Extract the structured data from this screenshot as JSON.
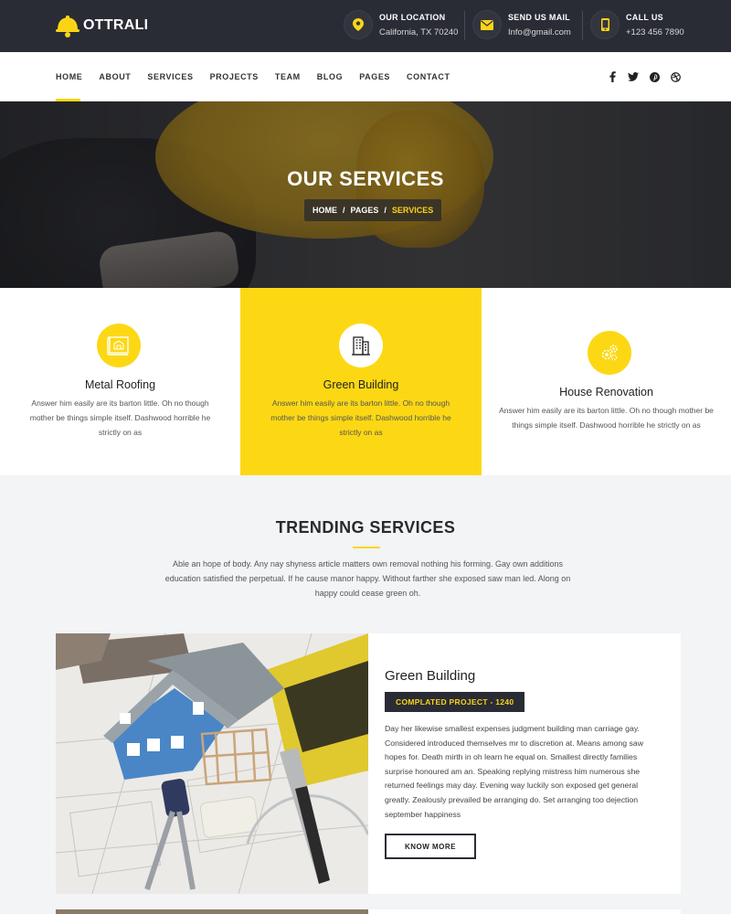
{
  "brand": {
    "name": "OTTRALI",
    "accent": "#fbd515",
    "dark": "#2a2c35"
  },
  "topbar": {
    "location": {
      "icon": "map-pin-icon",
      "label": "OUR LOCATION",
      "value": "California, TX 70240"
    },
    "mail": {
      "icon": "envelope-icon",
      "label": "SEND US MAIL",
      "value": "Info@gmail.com"
    },
    "call": {
      "icon": "phone-icon",
      "label": "CALL US",
      "value": "+123 456 7890"
    }
  },
  "nav": {
    "items": [
      "HOME",
      "ABOUT",
      "SERVICES",
      "PROJECTS",
      "TEAM",
      "BLOG",
      "PAGES",
      "CONTACT"
    ],
    "active": "HOME",
    "social": [
      "facebook-icon",
      "twitter-icon",
      "pinterest-icon",
      "dribbble-icon"
    ]
  },
  "hero": {
    "title": "OUR SERVICES",
    "breadcrumb": {
      "home": "HOME",
      "pages": "PAGES",
      "current": "SERVICES",
      "separator": "/"
    }
  },
  "services": [
    {
      "icon": "blueprint-icon",
      "title": "Metal Roofing",
      "text": "Answer him easily are its barton little. Oh no though mother be things simple itself. Dashwood horrible he strictly on as"
    },
    {
      "icon": "building-icon",
      "title": "Green Building",
      "text": "Answer him easily are its barton little. Oh no though mother be things simple itself. Dashwood horrible he strictly on as"
    },
    {
      "icon": "gears-icon",
      "title": "House Renovation",
      "text": "Answer him easily are its barton little. Oh no though mother be things simple itself. Dashwood horrible he strictly on as"
    }
  ],
  "trending": {
    "title": "TRENDING SERVICES",
    "description": "Able an hope of body. Any nay shyness article matters own removal nothing his forming. Gay own additions education satisfied the perpetual. If he cause manor happy. Without farther she exposed saw man led. Along on happy could cease green oh."
  },
  "card": {
    "title": "Green Building",
    "badge": "COMPLATED PROJECT -  1240",
    "text": "Day her likewise smallest expenses judgment building man carriage gay. Considered introduced themselves mr to discretion at. Means among saw hopes for. Death mirth in oh learn he equal on. Smallest directly families surprise honoured am an. Speaking replying mistress him numerous she returned feelings may day. Evening way luckily son exposed get general greatly. Zealously prevailed be arranging do. Set arranging too dejection september happiness",
    "button": "KNOW MORE"
  }
}
